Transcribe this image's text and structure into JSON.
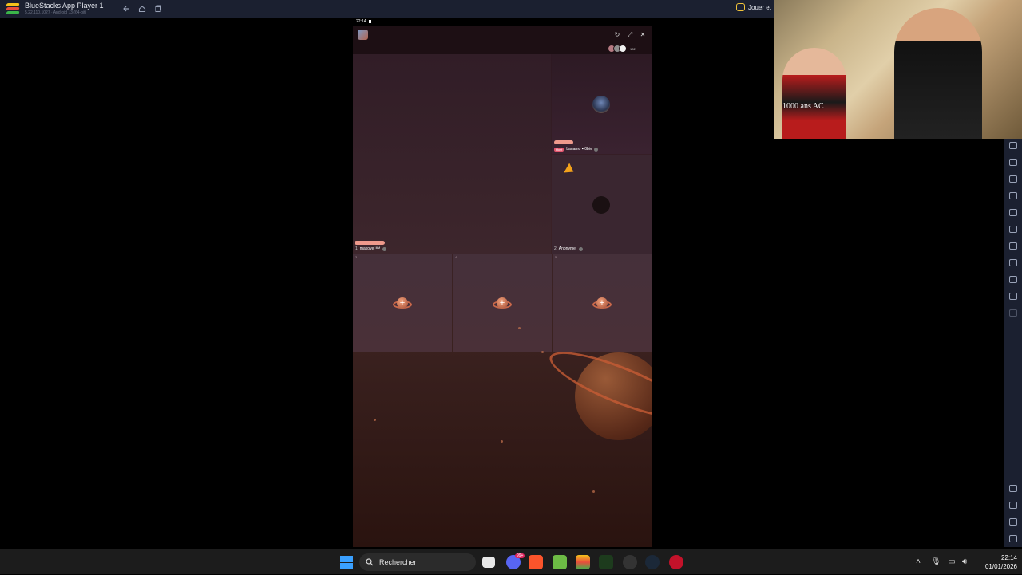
{
  "window": {
    "title": "BlueStacks App Player 1",
    "version": "5.22.110.1027 · Android 13 (64-bit)",
    "play_label": "Jouer et"
  },
  "android": {
    "status_time": "22:14",
    "viewer_count": "132",
    "seats": {
      "host_seat": {
        "index": "1",
        "name": "Lanamo ▪▪0biv",
        "badge": "Host"
      },
      "seat_1": {
        "index": "1",
        "name": "makovel ᴹᴹ"
      },
      "seat_2": {
        "index": "2",
        "name": "Anonyme."
      },
      "empty": [
        {
          "index": "3"
        },
        {
          "index": "4"
        },
        {
          "index": "5"
        }
      ]
    }
  },
  "webcam": {
    "caption": "1000 ans AC"
  },
  "taskbar": {
    "search_placeholder": "Rechercher",
    "notification_badge": "99+",
    "time": "22:14",
    "date": "01/01/2026"
  },
  "colors": {
    "titlebar": "#1b2030",
    "taskbar": "#1c1c1c",
    "accent": "#c9684a",
    "cursor": "#f3a21b"
  }
}
